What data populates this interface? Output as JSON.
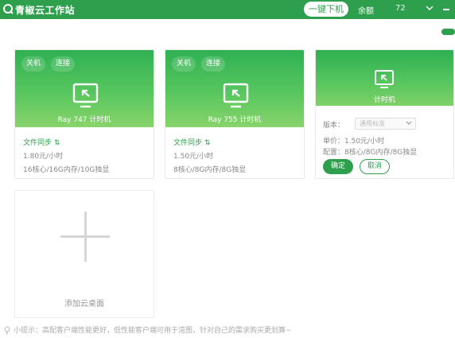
{
  "header": {
    "title": "青椒云工作站",
    "one_click_label": "一键下机",
    "balance_label": "余额",
    "user_suffix": "72"
  },
  "cards": [
    {
      "power_label": "关机",
      "connect_label": "连接",
      "name": "Ray 747 计时机",
      "sync_label": "文件同步",
      "price": "1.80元/小时",
      "config": "16核心/16G内存/10G独显"
    },
    {
      "power_label": "关机",
      "connect_label": "连接",
      "name": "Ray 755 计时机",
      "sync_label": "文件同步",
      "price": "1.50元/小时",
      "config": "8核心/8G内存/8G独显"
    }
  ],
  "new_card": {
    "name": "计时机",
    "version_label": "版本：",
    "version_value": "通用标准",
    "price": "单价：1.50元/小时",
    "config": "配置：8核心/8G内存/8G独显",
    "confirm_label": "确定",
    "cancel_label": "取消"
  },
  "add_desktop": {
    "label": "添加云桌面"
  },
  "footer": {
    "tip": "小提示：高配客户端性能更好，低性能客户端可用于渲图，针对自己的需求购买更划算~"
  },
  "colors": {
    "brand_green": "#2ea04d",
    "card_gradient_end": "#88d46b"
  }
}
